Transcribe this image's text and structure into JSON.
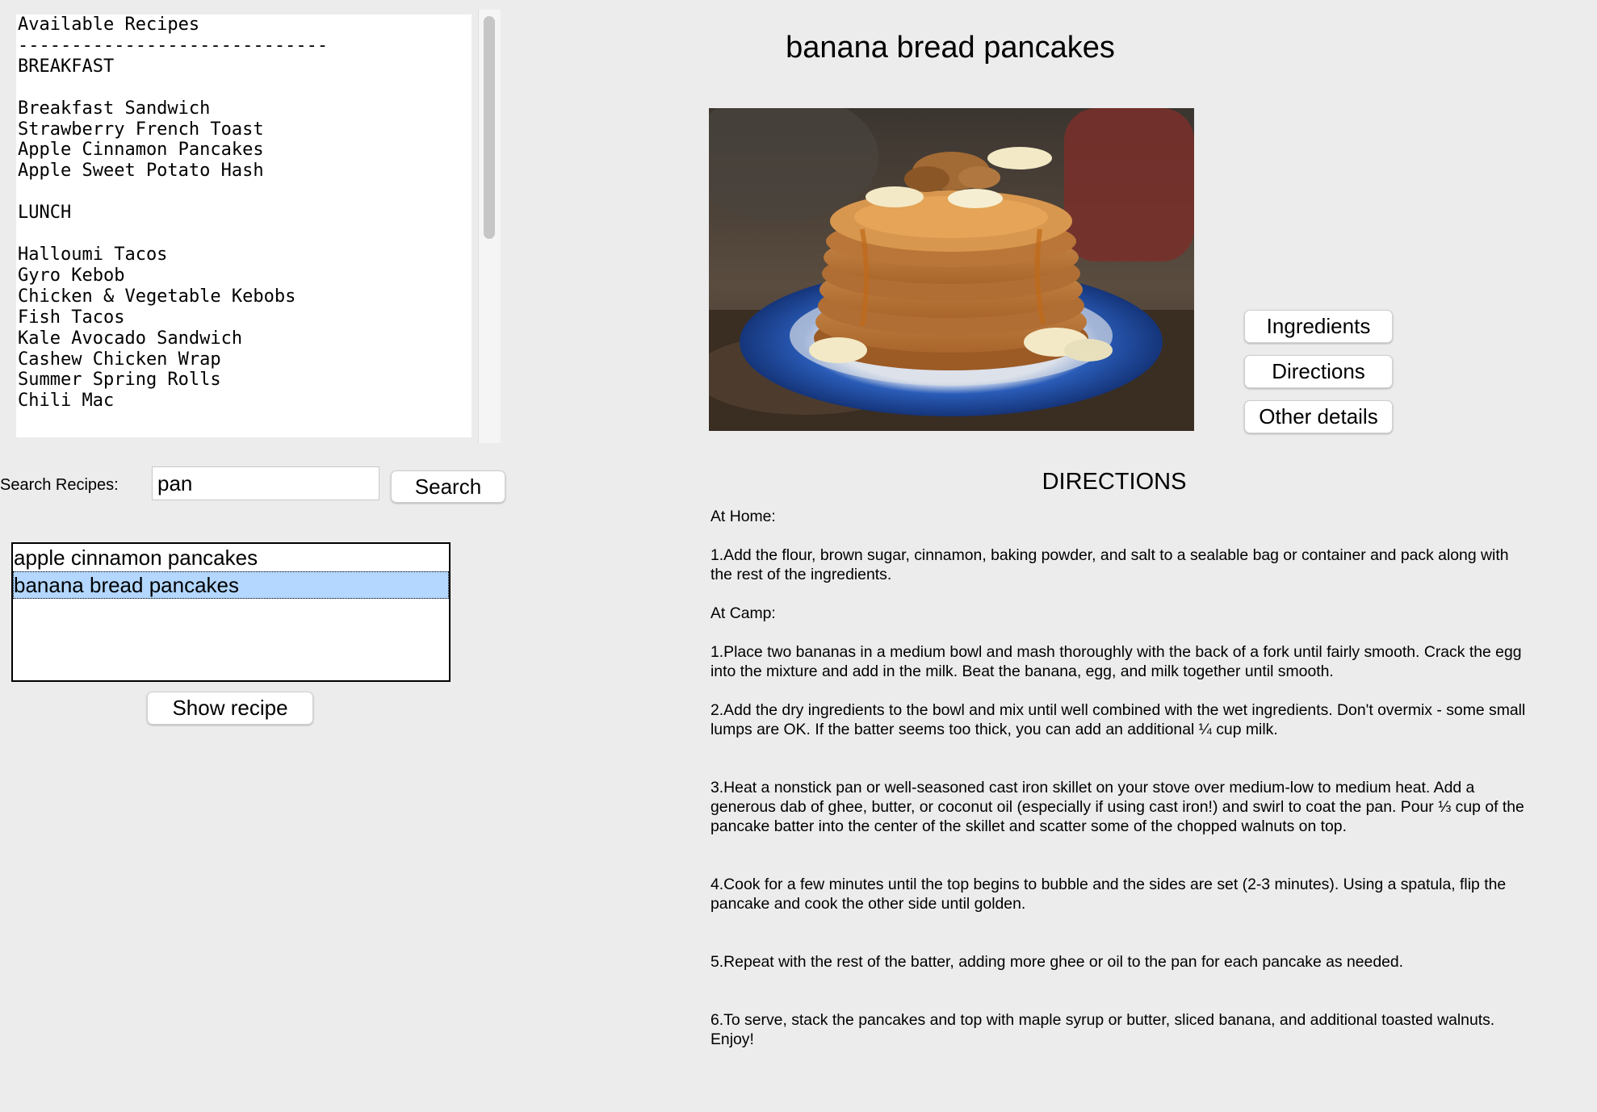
{
  "catalog": {
    "text": "Available Recipes\n-----------------------------\nBREAKFAST\n\nBreakfast Sandwich\nStrawberry French Toast\nApple Cinnamon Pancakes\nApple Sweet Potato Hash\n\nLUNCH\n\nHalloumi Tacos\nGyro Kebob\nChicken & Vegetable Kebobs\nFish Tacos\nKale Avocado Sandwich\nCashew Chicken Wrap\nSummer Spring Rolls\nChili Mac"
  },
  "search": {
    "label": "Search Recipes:",
    "value": "pan",
    "button_label": "Search"
  },
  "results": {
    "items": [
      "apple cinnamon pancakes",
      "banana bread pancakes"
    ],
    "selected_index": 1
  },
  "show_recipe_label": "Show recipe",
  "recipe": {
    "title": "banana bread pancakes",
    "image_icon": "pancake-stack-photo"
  },
  "view_buttons": {
    "ingredients": "Ingredients",
    "directions": "Directions",
    "other_details": "Other details"
  },
  "section": {
    "heading": "DIRECTIONS",
    "text": "At Home:\n\n1.Add the flour, brown sugar, cinnamon, baking powder, and salt to a sealable bag or container and pack along with the rest of the ingredients.\n\nAt Camp:\n\n1.Place two bananas in a medium bowl and mash thoroughly with the back of a fork until fairly smooth. Crack the egg into the mixture and add in the milk. Beat the banana, egg, and milk together until smooth.\n\n2.Add the dry ingredients to the bowl and mix until well combined with the wet ingredients. Don't overmix - some small lumps are OK. If the batter seems too thick, you can add an additional ¼ cup milk.\n\n\n3.Heat a nonstick pan or well-seasoned cast iron skillet on your stove over medium-low to medium heat. Add a generous dab of ghee, butter, or coconut oil (especially if using cast iron!) and swirl to coat the pan. Pour ⅓ cup of the pancake batter into the center of the skillet and scatter some of the chopped walnuts on top.\n\n\n4.Cook for a few minutes until the top begins to bubble and the sides are set (2-3 minutes). Using a spatula, flip the pancake and cook the other side until golden.\n\n\n5.Repeat with the rest of the batter, adding more ghee or oil to the pan for each pancake as needed.\n\n\n6.To serve, stack the pancakes and top with maple syrup or butter, sliced banana, and additional toasted walnuts. Enjoy!"
  },
  "colors": {
    "window_bg": "#ececec",
    "selection": "#b3d7ff",
    "plate_blue": "#1f4fa8"
  }
}
